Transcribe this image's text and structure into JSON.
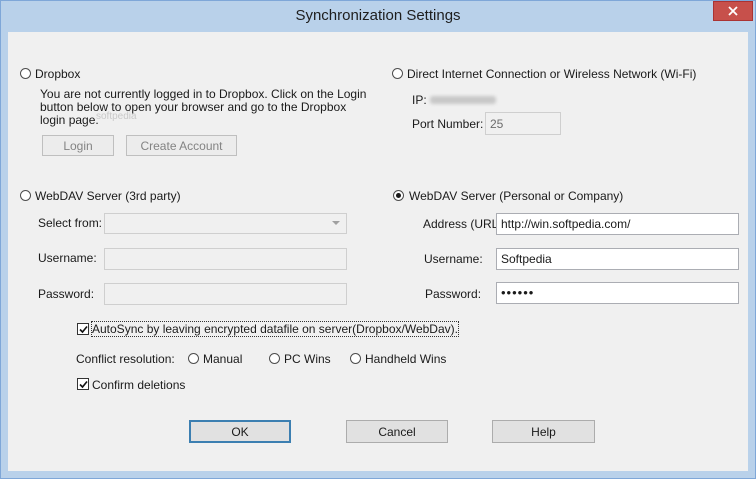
{
  "window": {
    "title": "Synchronization Settings"
  },
  "dropbox": {
    "label": "Dropbox",
    "message_line1": "You are not currently logged in to Dropbox. Click on the Login",
    "message_line2": "button below to open your browser and go to the Dropbox",
    "message_line3": "login page.",
    "login_label": "Login",
    "create_account_label": "Create Account",
    "selected": false
  },
  "direct": {
    "label": "Direct Internet Connection or Wireless Network (Wi-Fi)",
    "ip_label": "IP:",
    "port_label": "Port Number:",
    "port_value": "25",
    "selected": false
  },
  "webdav_3rd": {
    "label": "WebDAV Server (3rd party)",
    "select_from_label": "Select from:",
    "username_label": "Username:",
    "password_label": "Password:",
    "selected": false
  },
  "webdav_personal": {
    "label": "WebDAV Server (Personal or Company)",
    "address_label": "Address (URL):",
    "address_value": "http://win.softpedia.com/",
    "username_label": "Username:",
    "username_value": "Softpedia",
    "password_label": "Password:",
    "password_value": "••••••",
    "selected": true
  },
  "options": {
    "autosync_label": "AutoSync by leaving encrypted datafile on server(Dropbox/WebDav).",
    "autosync_checked": true,
    "conflict_label": "Conflict resolution:",
    "conflict_options": [
      "Manual",
      "PC Wins",
      "Handheld Wins"
    ],
    "confirm_label": "Confirm deletions",
    "confirm_checked": true
  },
  "buttons": {
    "ok": "OK",
    "cancel": "Cancel",
    "help": "Help"
  },
  "watermark": "softpedia"
}
